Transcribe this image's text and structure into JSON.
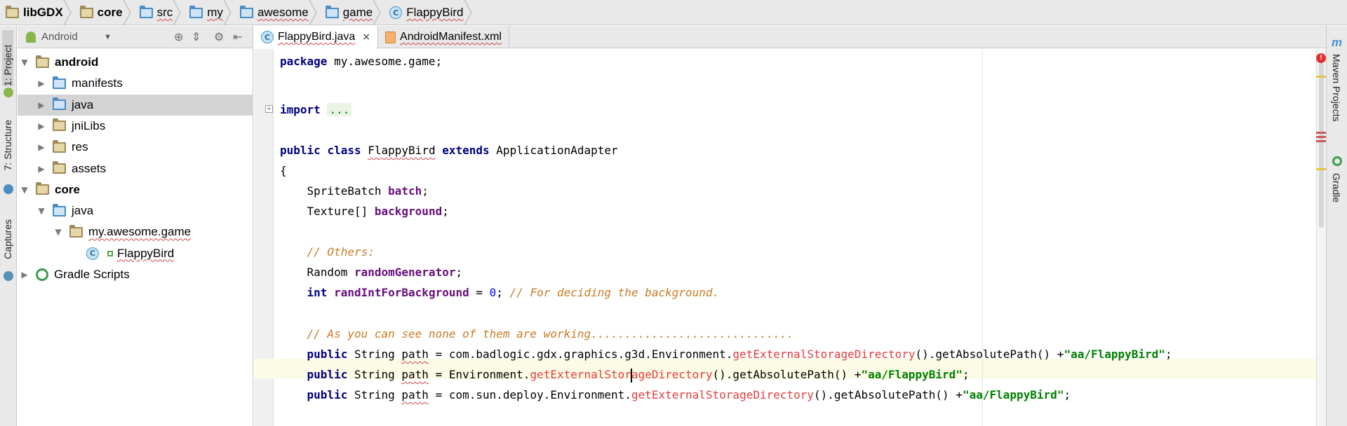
{
  "breadcrumbs": [
    {
      "label": "libGDX",
      "icon": "project-folder-icon",
      "bold": true
    },
    {
      "label": "core",
      "icon": "module-folder-icon",
      "bold": true
    },
    {
      "label": "src",
      "icon": "folder-icon",
      "bold": false
    },
    {
      "label": "my",
      "icon": "folder-icon",
      "bold": false
    },
    {
      "label": "awesome",
      "icon": "folder-icon",
      "bold": false
    },
    {
      "label": "game",
      "icon": "folder-icon",
      "bold": false
    },
    {
      "label": "FlappyBird",
      "icon": "class-icon",
      "bold": false
    }
  ],
  "left_strip": {
    "project_tab": "1: Project",
    "structure_tab": "7: Structure",
    "captures_tab": "Captures"
  },
  "project_panel": {
    "view_mode": "Android",
    "tree": [
      {
        "label": "android",
        "icon": "module-folder-icon",
        "expanded": true,
        "bold": true
      },
      {
        "label": "manifests",
        "icon": "folder-icon",
        "expanded": false
      },
      {
        "label": "java",
        "icon": "folder-icon",
        "expanded": false,
        "selected": true
      },
      {
        "label": "jniLibs",
        "icon": "resource-folder-icon",
        "expanded": false
      },
      {
        "label": "res",
        "icon": "resource-folder-icon",
        "expanded": false
      },
      {
        "label": "assets",
        "icon": "resource-folder-icon",
        "expanded": false
      },
      {
        "label": "core",
        "icon": "module-folder-icon",
        "expanded": true,
        "bold": true
      },
      {
        "label": "java",
        "icon": "folder-icon",
        "expanded": true
      },
      {
        "label": "my.awesome.game",
        "icon": "package-icon",
        "expanded": true
      },
      {
        "label": "FlappyBird",
        "icon": "class-icon"
      },
      {
        "label": "Gradle Scripts",
        "icon": "gradle-icon",
        "expanded": false
      }
    ]
  },
  "editor_tabs": [
    {
      "label": "FlappyBird.java",
      "icon": "class-icon",
      "active": true,
      "close": "×"
    },
    {
      "label": "AndroidManifest.xml",
      "icon": "xml-file-icon",
      "active": false,
      "close": "×"
    }
  ],
  "code": {
    "package_kw": "package",
    "package_name": " my.awesome.game;",
    "import_kw": "import",
    "import_fold": "...",
    "class_kw1": "public",
    "class_kw2": "class",
    "class_name": "FlappyBird",
    "extends_kw": "extends",
    "superclass": "ApplicationAdapter",
    "open_brace": "{",
    "batch_type": "SpriteBatch",
    "batch_name": "batch",
    "bg_type": "Texture[]",
    "bg_name": "background",
    "comment_others": "// Others:",
    "rand_type": "Random",
    "rand_name": "randomGenerator",
    "int_kw": "int",
    "randint_name": "randIntForBackground",
    "randint_value": "0",
    "randint_comment": "// For deciding the background.",
    "comment_working": "// As you can see none of them are working..............................",
    "path_kw": "public",
    "string_type": "String",
    "path_name": "path",
    "line1_prefix": "com.badlogic.gdx.graphics.g3d.Environment.",
    "line2_prefix": "Environment.",
    "line3_prefix": "com.sun.deploy.Environment.",
    "method_name": "getExternalStorageDirectory",
    "method_name_a": "getExternalStor",
    "method_name_b": "ageDirectory",
    "suffix": "().getAbsolutePath() +",
    "string_literal": "\"aa/FlappyBird\"",
    "semicolon": ";"
  },
  "right_strip": {
    "maven_tab": "Maven Projects",
    "gradle_tab": "Gradle"
  },
  "colors": {
    "keyword": "#000080",
    "field": "#660e7a",
    "comment": "#c87b24",
    "string": "#008000",
    "method_error": "#e43c3c"
  }
}
